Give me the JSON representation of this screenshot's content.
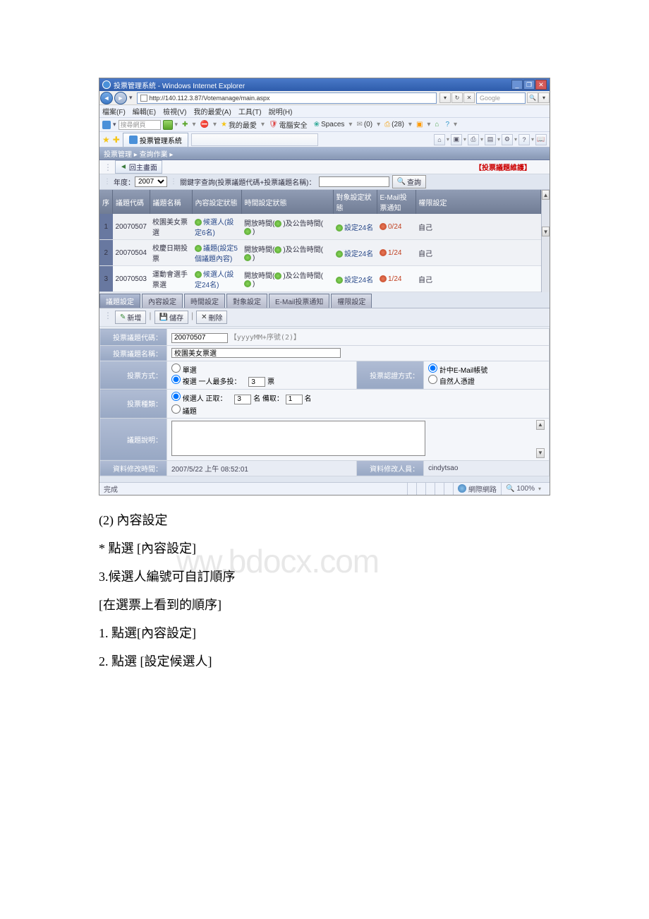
{
  "window": {
    "title": "投票管理系統 - Windows Internet Explorer",
    "url": "http://140.112.3.87/Votemanage/main.aspx",
    "search_placeholder": "Google"
  },
  "menu": {
    "file": "檔案(F)",
    "edit": "編輯(E)",
    "view": "檢視(V)",
    "fav": "我的最愛(A)",
    "tools": "工具(T)",
    "help": "說明(H)"
  },
  "links": {
    "search": "搜尋網頁",
    "myfav": "我的最愛",
    "pcsafe": "電腦安全",
    "spaces": "Spaces",
    "mail_count": "(0)",
    "print_count": "(28)"
  },
  "tab": {
    "title": "投票管理系統"
  },
  "crumbs": "投票管理 ▸  查詢作業 ▸",
  "toolbar": {
    "back": "回主畫面",
    "maint": "【投票議題維護】"
  },
  "filter": {
    "year_label": "年度：",
    "year_value": "2007",
    "keyword_label": "關鍵字查詢(投票議題代碼+投票議題名稱)：",
    "query_btn": "查詢"
  },
  "cols": {
    "seq": "序",
    "code": "議題代碼",
    "name": "議題名稱",
    "content": "內容設定狀態",
    "time": "時間設定狀態",
    "target": "對象設定狀態",
    "email": "E-Mail投票通知",
    "perm": "權限設定"
  },
  "rows": [
    {
      "seq": "1",
      "code": "20070507",
      "name": "校園美女票選",
      "content": "候選人(設定6名)",
      "time_a": "開放時間(",
      "time_b": ")及公告時間(",
      "time_c": ")",
      "target": "設定24名",
      "email": "0/24",
      "perm": "自己"
    },
    {
      "seq": "2",
      "code": "20070504",
      "name": "校慶日期投票",
      "content": "議題(設定5個議題內容)",
      "time_a": "開放時間(",
      "time_b": ")及公告時間(",
      "time_c": ")",
      "target": "設定24名",
      "email": "1/24",
      "perm": "自己"
    },
    {
      "seq": "3",
      "code": "20070503",
      "name": "運動會選手票選",
      "content": "候選人(設定24名)",
      "time_a": "開放時間(",
      "time_b": ")及公告時間(",
      "time_c": ")",
      "target": "設定24名",
      "email": "1/24",
      "perm": "自己"
    }
  ],
  "subtabs": {
    "t1": "議題設定",
    "t2": "內容設定",
    "t3": "時間設定",
    "t4": "對象設定",
    "t5": "E-Mail投票通知",
    "t6": "權限設定"
  },
  "subtool": {
    "add": "新增",
    "save": "儲存",
    "del": "刪除"
  },
  "form": {
    "code_label": "投票議題代碼：",
    "code_value": "20070507",
    "code_hint": "【yyyyMM+序號(2)】",
    "name_label": "投票議題名稱：",
    "name_value": "校園美女票選",
    "method_label": "投票方式：",
    "single": "單選",
    "multi": "複選  一人最多投：",
    "multi_value": "3",
    "multi_unit": "票",
    "auth_label": "投票認證方式：",
    "auth1": "計中E-Mail帳號",
    "auth2": "自然人憑證",
    "kind_label": "投票種類：",
    "kind1a": "候選人  正取：",
    "kind1a_val": "3",
    "kind1b": "名 備取：",
    "kind1b_val": "1",
    "kind1c": "名",
    "kind2": "議題",
    "desc_label": "議題說明：",
    "mtime_label": "資料修改時間：",
    "mtime_value": "2007/5/22 上午 08:52:01",
    "muser_label": "資料修改人員：",
    "muser_value": "cindytsao"
  },
  "status": {
    "done": "完成",
    "net": "網際網路",
    "zoom": "100%"
  },
  "doc": {
    "h2": "(2) 內容設定",
    "wm": "ww.bdocx.com",
    "p1": "* 點選 [內容設定]",
    "p2": "3.候選人編號可自訂順序",
    "p3": "[在選票上看到的順序]",
    "p4": "1. 點選[內容設定]",
    "p5": "2. 點選 [設定候選人]"
  }
}
